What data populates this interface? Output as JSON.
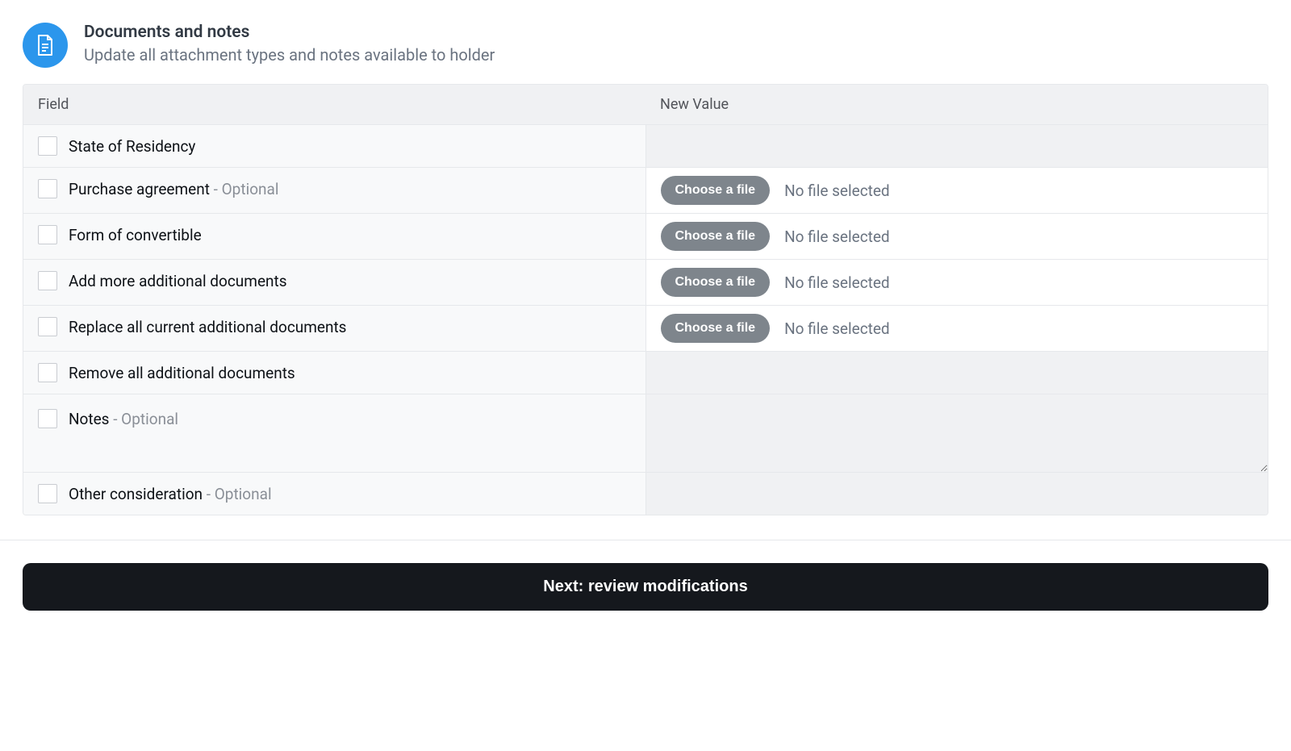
{
  "header": {
    "title": "Documents and notes",
    "subtitle": "Update all attachment types and notes available to holder"
  },
  "table": {
    "columns": {
      "field": "Field",
      "new_value": "New Value"
    },
    "optional_suffix": " - Optional",
    "choose_label": "Choose a file",
    "no_file_label": "No file selected",
    "rows": {
      "state_of_residency": {
        "label": "State of Residency"
      },
      "purchase_agreement": {
        "label": "Purchase agreement"
      },
      "form_of_convertible": {
        "label": "Form of convertible"
      },
      "add_more_docs": {
        "label": "Add more additional documents"
      },
      "replace_docs": {
        "label": "Replace all current additional documents"
      },
      "remove_docs": {
        "label": "Remove all additional documents"
      },
      "notes": {
        "label": "Notes"
      },
      "other_consideration": {
        "label": "Other consideration"
      }
    }
  },
  "footer": {
    "next_label": "Next: review modifications"
  }
}
